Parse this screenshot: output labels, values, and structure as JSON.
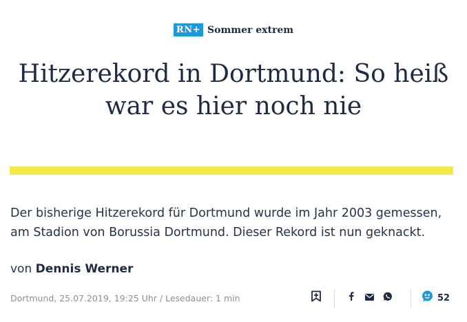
{
  "kicker": {
    "badge": "RN+",
    "label": "Sommer extrem"
  },
  "article": {
    "headline_line1": "Hitzerekord in Dortmund: So heiß",
    "headline_line2": "war es hier noch nie",
    "teaser": "Der bisherige Hitzerekord für Dortmund wurde im Jahr 2003 gemessen, am Stadion von Borussia Dortmund. Dieser Rekord ist nun geknackt.",
    "byline_prefix": "von",
    "author": "Dennis Werner",
    "meta": "Dortmund, 25.07.2019, 19:25 Uhr / Lesedauer: 1 min"
  },
  "actions": {
    "bookmark_icon": "bookmark-plus-icon",
    "facebook_icon": "facebook-icon",
    "mail_icon": "mail-icon",
    "whatsapp_icon": "whatsapp-icon",
    "comment_icon": "comment-bubble-icon",
    "comment_count": "52"
  },
  "colors": {
    "text_primary": "#1f2a44",
    "brand_blue": "#1d98d8",
    "highlight_yellow": "#f4e84a",
    "meta_gray": "#8a8f99"
  }
}
